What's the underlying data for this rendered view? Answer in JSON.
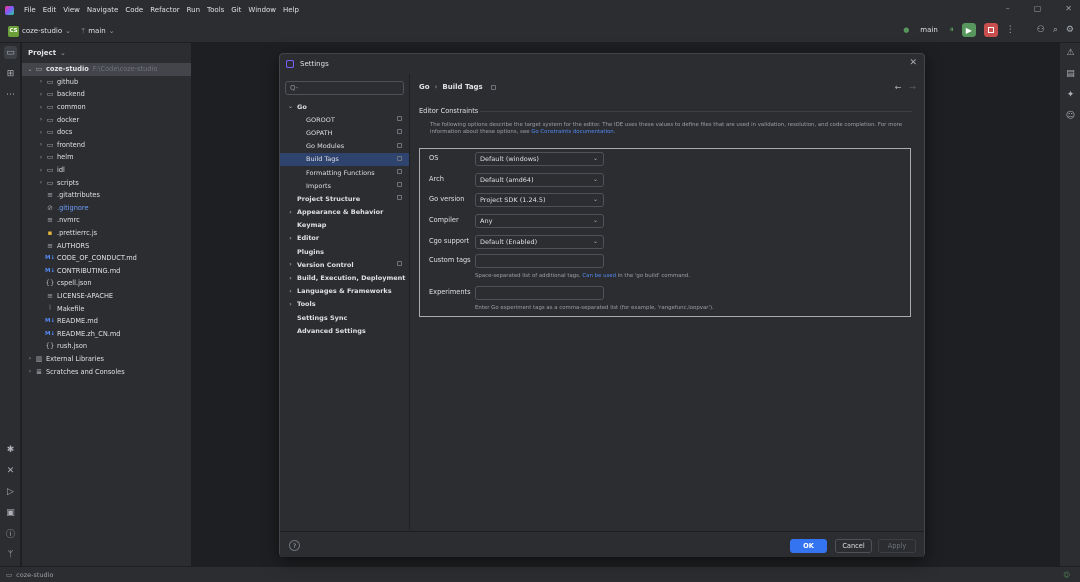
{
  "menu": [
    "File",
    "Edit",
    "View",
    "Navigate",
    "Code",
    "Refactor",
    "Run",
    "Tools",
    "Git",
    "Window",
    "Help"
  ],
  "window_controls": [
    "–",
    "▢",
    "✕"
  ],
  "toolbar": {
    "project_badge": "CS",
    "project": "coze-studio",
    "branch": "main",
    "run_config": "main"
  },
  "project_panel": {
    "title": "Project",
    "root": {
      "name": "coze-studio",
      "path": "F:\\Code\\coze-studio"
    },
    "items": [
      {
        "label": "github",
        "icon": "folder",
        "chevron": "›",
        "level": 1
      },
      {
        "label": "backend",
        "icon": "folder",
        "chevron": "›",
        "level": 1
      },
      {
        "label": "common",
        "icon": "folder",
        "chevron": "›",
        "level": 1
      },
      {
        "label": "docker",
        "icon": "folder",
        "chevron": "›",
        "level": 1
      },
      {
        "label": "docs",
        "icon": "folder",
        "chevron": "›",
        "level": 1
      },
      {
        "label": "frontend",
        "icon": "folder",
        "chevron": "›",
        "level": 1
      },
      {
        "label": "helm",
        "icon": "folder",
        "chevron": "›",
        "level": 1
      },
      {
        "label": "idl",
        "icon": "folder",
        "chevron": "›",
        "level": 1
      },
      {
        "label": "scripts",
        "icon": "folder",
        "chevron": "›",
        "level": 1
      },
      {
        "label": ".gitattributes",
        "icon": "file",
        "chevron": "",
        "level": 1
      },
      {
        "label": ".gitignore",
        "icon": "gitignore",
        "chevron": "",
        "level": 1
      },
      {
        "label": ".nvmrc",
        "icon": "file",
        "chevron": "",
        "level": 1
      },
      {
        "label": ".prettierrc.js",
        "icon": "js",
        "chevron": "",
        "level": 1
      },
      {
        "label": "AUTHORS",
        "icon": "file",
        "chevron": "",
        "level": 1
      },
      {
        "label": "CODE_OF_CONDUCT.md",
        "icon": "md",
        "chevron": "",
        "level": 1
      },
      {
        "label": "CONTRIBUTING.md",
        "icon": "md",
        "chevron": "",
        "level": 1
      },
      {
        "label": "cspell.json",
        "icon": "json",
        "chevron": "",
        "level": 1
      },
      {
        "label": "LICENSE-APACHE",
        "icon": "file",
        "chevron": "",
        "level": 1
      },
      {
        "label": "Makefile",
        "icon": "makefile",
        "chevron": "",
        "level": 1
      },
      {
        "label": "README.md",
        "icon": "md",
        "chevron": "",
        "level": 1
      },
      {
        "label": "README.zh_CN.md",
        "icon": "md",
        "chevron": "",
        "level": 1
      },
      {
        "label": "rush.json",
        "icon": "json",
        "chevron": "",
        "level": 1
      },
      {
        "label": "External Libraries",
        "icon": "library",
        "chevron": "›",
        "level": 0
      },
      {
        "label": "Scratches and Consoles",
        "icon": "scratch",
        "chevron": "›",
        "level": 0
      }
    ]
  },
  "status_bar": {
    "project": "coze-studio"
  },
  "settings": {
    "title": "Settings",
    "search_placeholder": "Q-",
    "nav": [
      {
        "label": "Go",
        "chevron": "⌄",
        "bold": true,
        "indent": 0,
        "pin": false,
        "selected": false
      },
      {
        "label": "GOROOT",
        "chevron": "",
        "bold": false,
        "indent": 2,
        "pin": true,
        "selected": false
      },
      {
        "label": "GOPATH",
        "chevron": "",
        "bold": false,
        "indent": 2,
        "pin": true,
        "selected": false
      },
      {
        "label": "Go Modules",
        "chevron": "",
        "bold": false,
        "indent": 2,
        "pin": true,
        "selected": false
      },
      {
        "label": "Build Tags",
        "chevron": "",
        "bold": false,
        "indent": 2,
        "pin": true,
        "selected": true
      },
      {
        "label": "Formatting Functions",
        "chevron": "",
        "bold": false,
        "indent": 2,
        "pin": true,
        "selected": false
      },
      {
        "label": "Imports",
        "chevron": "",
        "bold": false,
        "indent": 2,
        "pin": true,
        "selected": false
      },
      {
        "label": "Project Structure",
        "chevron": "",
        "bold": true,
        "indent": 1,
        "pin": true,
        "selected": false
      },
      {
        "label": "Appearance & Behavior",
        "chevron": "›",
        "bold": true,
        "indent": 0,
        "pin": false,
        "selected": false
      },
      {
        "label": "Keymap",
        "chevron": "",
        "bold": true,
        "indent": 1,
        "pin": false,
        "selected": false
      },
      {
        "label": "Editor",
        "chevron": "›",
        "bold": true,
        "indent": 0,
        "pin": false,
        "selected": false
      },
      {
        "label": "Plugins",
        "chevron": "",
        "bold": true,
        "indent": 1,
        "pin": false,
        "selected": false
      },
      {
        "label": "Version Control",
        "chevron": "›",
        "bold": true,
        "indent": 0,
        "pin": true,
        "selected": false
      },
      {
        "label": "Build, Execution, Deployment",
        "chevron": "›",
        "bold": true,
        "indent": 0,
        "pin": false,
        "selected": false
      },
      {
        "label": "Languages & Frameworks",
        "chevron": "›",
        "bold": true,
        "indent": 0,
        "pin": false,
        "selected": false
      },
      {
        "label": "Tools",
        "chevron": "›",
        "bold": true,
        "indent": 0,
        "pin": false,
        "selected": false
      },
      {
        "label": "Settings Sync",
        "chevron": "",
        "bold": true,
        "indent": 1,
        "pin": false,
        "selected": false
      },
      {
        "label": "Advanced Settings",
        "chevron": "",
        "bold": true,
        "indent": 1,
        "pin": false,
        "selected": false
      }
    ],
    "breadcrumb": {
      "parent": "Go",
      "current": "Build Tags"
    },
    "section_title": "Editor Constraints",
    "description": {
      "text": "The following options describe the target system for the editor. The IDE uses these values to define files that are used in validation, resolution, and code completion. For more information about these options, see ",
      "link": "Go Constraints documentation",
      "end": "."
    },
    "fields": {
      "os": {
        "label": "OS",
        "value": "Default (windows)"
      },
      "arch": {
        "label": "Arch",
        "value": "Default (amd64)"
      },
      "go_version": {
        "label": "Go version",
        "value": "Project SDK (1.24.5)"
      },
      "compiler": {
        "label": "Compiler",
        "value": "Any"
      },
      "cgo_support": {
        "label": "Cgo support",
        "value": "Default (Enabled)"
      },
      "custom_tags": {
        "label": "Custom tags",
        "value": "",
        "hint_before": "Space-separated list of additional tags. ",
        "hint_link": "Can be used",
        "hint_after": " in the 'go build' command."
      },
      "experiments": {
        "label": "Experiments",
        "value": "",
        "hint": "Enter Go experiment tags as a comma-separated list (for example, 'rangefunc,loopvar')."
      }
    },
    "buttons": {
      "ok": "OK",
      "cancel": "Cancel",
      "apply": "Apply",
      "help": "?"
    }
  },
  "colors": {
    "accent": "#3574f0",
    "selection": "#2e436e",
    "run_green": "#57965c",
    "stop_red": "#c94f4f"
  }
}
